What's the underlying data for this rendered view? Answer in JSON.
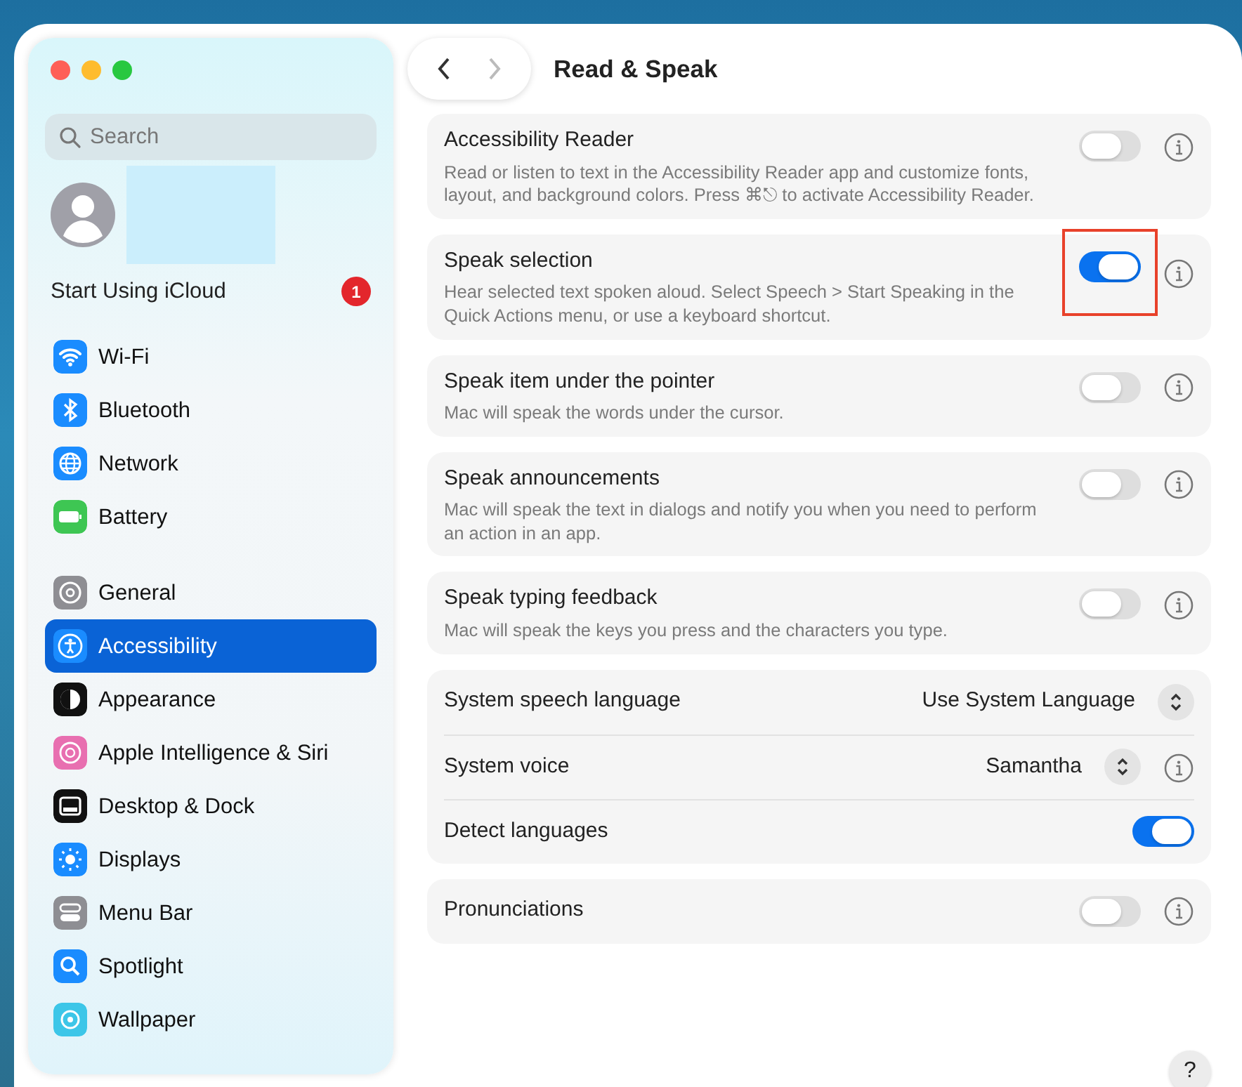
{
  "window": {
    "title": "Read & Speak"
  },
  "sidebar": {
    "search": {
      "placeholder": "Search"
    },
    "account": {
      "title": "Start Using iCloud",
      "badge": "1"
    },
    "sections": [
      {
        "items": [
          {
            "label": "Wi-Fi",
            "kind": "wifi",
            "selected": false
          },
          {
            "label": "Bluetooth",
            "kind": "bluetooth",
            "selected": false
          },
          {
            "label": "Network",
            "kind": "network",
            "selected": false
          },
          {
            "label": "Battery",
            "kind": "battery",
            "selected": false
          }
        ]
      },
      {
        "items": [
          {
            "label": "General",
            "kind": "general",
            "selected": false
          },
          {
            "label": "Accessibility",
            "kind": "accessibility",
            "selected": true
          },
          {
            "label": "Appearance",
            "kind": "appearance",
            "selected": false
          },
          {
            "label": "Apple Intelligence & Siri",
            "kind": "siri",
            "selected": false
          },
          {
            "label": "Desktop & Dock",
            "kind": "desktop",
            "selected": false
          },
          {
            "label": "Displays",
            "kind": "displays",
            "selected": false
          },
          {
            "label": "Menu Bar",
            "kind": "menubar",
            "selected": false
          },
          {
            "label": "Spotlight",
            "kind": "spotlight",
            "selected": false
          },
          {
            "label": "Wallpaper",
            "kind": "wallpaper",
            "selected": false
          }
        ]
      }
    ]
  },
  "groups": [
    {
      "rows": [
        {
          "kind": "toggle",
          "title": "Accessibility Reader",
          "description": "Read or listen to text in the Accessibility Reader app and customize fonts, layout, and background colors. Press ⌘⎋ to activate Accessibility Reader.",
          "on": false,
          "info": true,
          "highlighted": false
        }
      ]
    },
    {
      "rows": [
        {
          "kind": "toggle",
          "title": "Speak selection",
          "description": "Hear selected text spoken aloud. Select Speech > Start Speaking in the Quick Actions menu, or use a keyboard shortcut.",
          "on": true,
          "info": true,
          "highlighted": true
        }
      ]
    },
    {
      "rows": [
        {
          "kind": "toggle",
          "title": "Speak item under the pointer",
          "description": "Mac will speak the words under the cursor.",
          "on": false,
          "info": true,
          "highlighted": false
        }
      ]
    },
    {
      "rows": [
        {
          "kind": "toggle",
          "title": "Speak announcements",
          "description": "Mac will speak the text in dialogs and notify you when you need to perform an action in an app.",
          "on": false,
          "info": true,
          "highlighted": false
        }
      ]
    },
    {
      "rows": [
        {
          "kind": "toggle",
          "title": "Speak typing feedback",
          "description": "Mac will speak the keys you press and the characters you type.",
          "on": false,
          "info": true,
          "highlighted": false
        }
      ]
    },
    {
      "rows": [
        {
          "kind": "popup",
          "title": "System speech language",
          "value": "Use System Language",
          "info": false
        },
        {
          "kind": "popup",
          "title": "System voice",
          "value": "Samantha",
          "info": true
        },
        {
          "kind": "toggle",
          "title": "Detect languages",
          "on": true,
          "info": false,
          "highlighted": false
        }
      ]
    },
    {
      "rows": [
        {
          "kind": "toggle",
          "title": "Pronunciations",
          "on": false,
          "info": true,
          "highlighted": false
        }
      ]
    }
  ],
  "help_button": "?"
}
